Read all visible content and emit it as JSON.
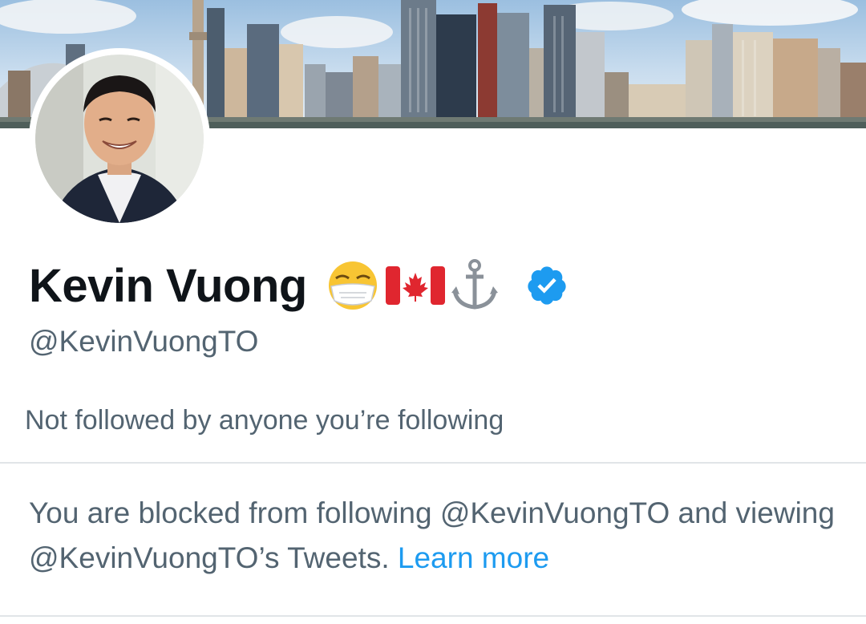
{
  "profile": {
    "display_name": "Kevin Vuong",
    "name_emojis": [
      "face-with-medical-mask-emoji",
      "canada-flag-emoji",
      "anchor-emoji"
    ],
    "verified": true,
    "handle": "@KevinVuongTO",
    "followers_you_know": "Not followed by anyone you’re following"
  },
  "blocked_notice": {
    "text": "You are blocked from following @KevinVuongTO and viewing @KevinVuongTO’s Tweets.",
    "link_label": "Learn more"
  },
  "colors": {
    "text_primary": "#0f1419",
    "text_secondary": "#536471",
    "link": "#1d9bf0",
    "verified_badge": "#1d9bf0",
    "divider": "#e1e5e8"
  }
}
